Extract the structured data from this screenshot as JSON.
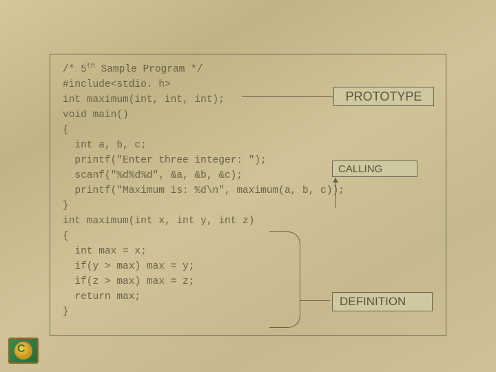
{
  "code": {
    "l1a": "/* 5",
    "l1b": " Sample Program */",
    "sup": "th",
    "l2": "#include<stdio. h>",
    "l3": "int maximum(int, int, int);",
    "l4": "void main()",
    "l5": "{",
    "l6": "  int a, b, c;",
    "l7": "  printf(\"Enter three integer: \");",
    "l8": "  scanf(\"%d%d%d\", &a, &b, &c);",
    "l9": "  printf(\"Maximum is: %d\\n\", maximum(a, b, c));",
    "l10": "}",
    "l11": "int maximum(int x, int y, int z)",
    "l12": "{",
    "l13": "  int max = x;",
    "l14": "  if(y > max) max = y;",
    "l15": "  if(z > max) max = z;",
    "l16": "  return max;",
    "l17": "}"
  },
  "labels": {
    "prototype": "PROTOTYPE",
    "calling": "CALLING",
    "definition": "DEFINITION"
  }
}
